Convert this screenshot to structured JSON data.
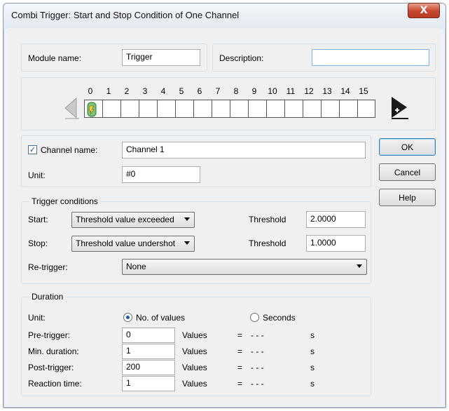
{
  "window": {
    "title": "Combi Trigger: Start and Stop Condition of One Channel",
    "close_glyph": "X"
  },
  "module": {
    "name_label": "Module name:",
    "name_value": "Trigger",
    "description_label": "Description:",
    "description_value": ""
  },
  "channels": {
    "numbers": [
      "0",
      "1",
      "2",
      "3",
      "4",
      "5",
      "6",
      "7",
      "8",
      "9",
      "10",
      "11",
      "12",
      "13",
      "14",
      "15"
    ],
    "active_index": 0,
    "prev_icon": "scroll-left-arrow-icon",
    "next_icon": "add-channel-arrow-icon"
  },
  "channel": {
    "checkbox_checked": true,
    "checkbox_glyph": "✓",
    "name_label": "Channel name:",
    "name_value": "Channel 1",
    "unit_label": "Unit:",
    "unit_value": "#0"
  },
  "buttons": {
    "ok": "OK",
    "cancel": "Cancel",
    "help": "Help"
  },
  "trigger": {
    "legend": "Trigger conditions",
    "start_label": "Start:",
    "start_value": "Threshold value exceeded",
    "start_threshold_label": "Threshold",
    "start_threshold_value": "2.0000",
    "stop_label": "Stop:",
    "stop_value": "Threshold value undershot",
    "stop_threshold_label": "Threshold",
    "stop_threshold_value": "1.0000",
    "retrigger_label": "Re-trigger:",
    "retrigger_value": "None"
  },
  "duration": {
    "legend": "Duration",
    "unit_label": "Unit:",
    "option_values": "No. of values",
    "option_seconds": "Seconds",
    "selected": "values",
    "rows": [
      {
        "label": "Pre-trigger:",
        "value": "0",
        "unit": "Values",
        "eq": "=",
        "result": "- - -",
        "sec": "s"
      },
      {
        "label": "Min. duration:",
        "value": "1",
        "unit": "Values",
        "eq": "=",
        "result": "- - -",
        "sec": "s"
      },
      {
        "label": "Post-trigger:",
        "value": "200",
        "unit": "Values",
        "eq": "=",
        "result": "- - -",
        "sec": "s"
      },
      {
        "label": "Reaction time:",
        "value": "1",
        "unit": "Values",
        "eq": "=",
        "result": "- - -",
        "sec": "s"
      }
    ]
  },
  "colors": {
    "close_button": "#c94b32",
    "active_channel_icon": "#2d9a2d",
    "field_focus_border": "#7eb4ea"
  }
}
